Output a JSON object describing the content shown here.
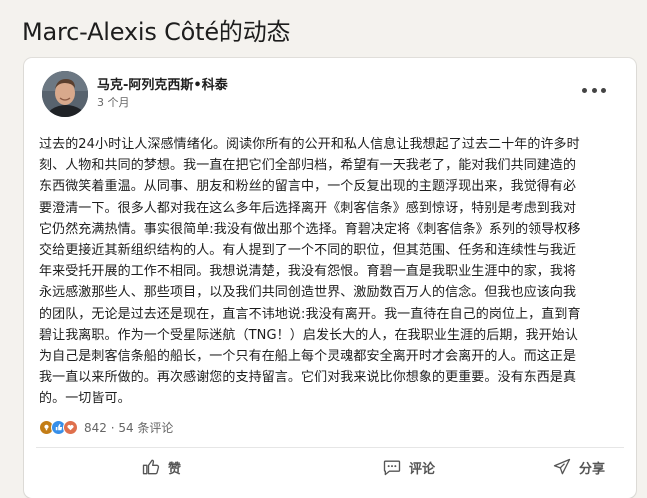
{
  "page_title": "Marc-Alexis Côté的动态",
  "post": {
    "author_name": "马克-阿列克西斯•科泰",
    "time": "3 个月",
    "body_lines": [
      "过去的24小时让人深感情绪化。阅读你所有的公开和私人信息让我想起了过去二十年的许多时",
      "刻、人物和共同的梦想。我一直在把它们全部归档，希望有一天我老了，能对我们共同建造的",
      "东西微笑着重温。从同事、朋友和粉丝的留言中，一个反复出现的主题浮现出来，我觉得有必",
      "要澄清一下。很多人都对我在这么多年后选择离开《刺客信条》感到惊讶，特别是考虑到我对",
      "它仍然充满热情。事实很简单:我没有做出那个选择。育碧决定将《刺客信条》系列的领导权移",
      "交给更接近其新组织结构的人。有人提到了一个不同的职位，但其范围、任务和连续性与我近",
      "年来受托开展的工作不相同。我想说清楚，我没有怨恨。育碧一直是我职业生涯中的家，我将",
      "永远感激那些人、那些项目，以及我们共同创造世界、激励数百万人的信念。但我也应该向我",
      "的团队，无论是过去还是现在，直言不讳地说:我没有离开。我一直待在自己的岗位上，直到育",
      "碧让我离职。作为一个受星际迷航（TNG！）启发长大的人，在我职业生涯的后期，我开始认",
      "为自己是刺客信条船的船长，一个只有在船上每个灵魂都安全离开时才会离开的人。而这正是",
      "我一直以来所做的。再次感谢您的支持留言。它们对我来说比你想象的更重要。没有东西是真",
      "的。一切皆可。"
    ],
    "reaction_count_text": "842 · 54 条评论",
    "actions": {
      "like": "赞",
      "comment": "评论",
      "share": "分享"
    }
  },
  "colors": {
    "page_bg": "#f4f2ee",
    "like_blue": "#378fe9",
    "celebrate": "#6dae4f",
    "love": "#df704d",
    "text_primary": "#1d1d1d",
    "text_secondary": "#666666"
  },
  "icons": [
    "ellipsis-icon",
    "like-icon",
    "comment-icon",
    "share-icon"
  ]
}
